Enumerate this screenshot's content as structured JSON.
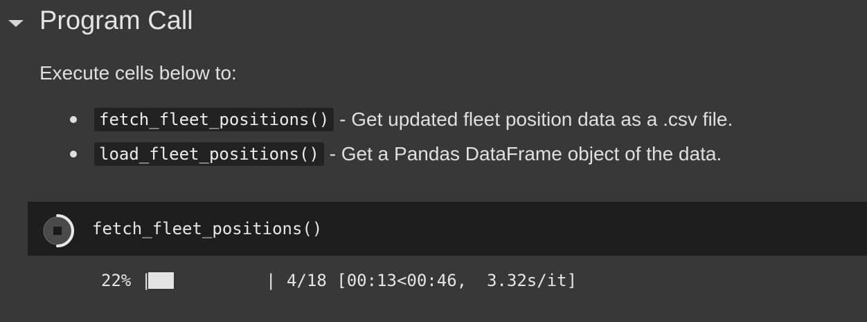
{
  "section": {
    "title": "Program Call",
    "toggle_icon": "caret-down-icon"
  },
  "intro": {
    "text": "Execute cells below to:"
  },
  "bullets": [
    {
      "code": "fetch_fleet_positions()",
      "description": " - Get updated fleet position data as a .csv file."
    },
    {
      "code": "load_fleet_positions()",
      "description": " - Get a Pandas DataFrame object of the data."
    }
  ],
  "code_cell": {
    "run_icon": "stop-execution-icon",
    "source": "fetch_fleet_positions()",
    "status": "running"
  },
  "output": {
    "percent": "22%",
    "bar_left": "|",
    "bar_right": "|",
    "fraction_filled": 0.22,
    "stats": "4/18 [00:13<00:46,  3.32s/it]"
  },
  "colors": {
    "background": "#383838",
    "code_cell_background": "#1e1e1e",
    "code_chip_background": "#222222",
    "text": "#e0e0e0",
    "progress_fill": "#e3e3e3"
  }
}
